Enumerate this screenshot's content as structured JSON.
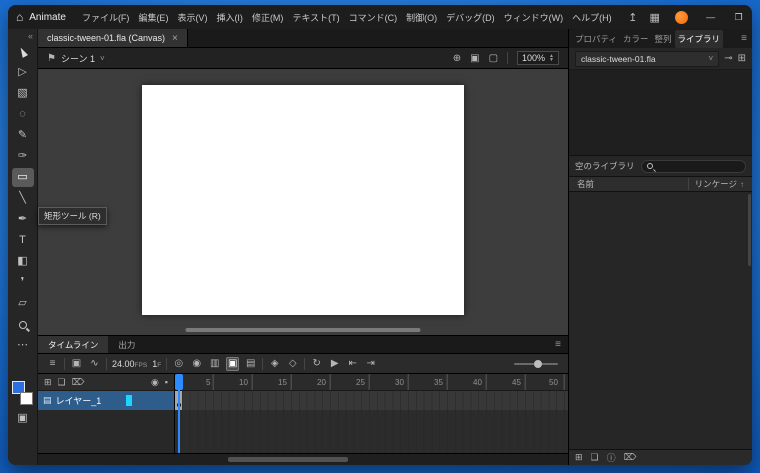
{
  "titlebar": {
    "app_name": "Animate",
    "menus": [
      "ファイル(F)",
      "編集(E)",
      "表示(V)",
      "挿入(I)",
      "修正(M)",
      "テキスト(T)",
      "コマンド(C)",
      "制御(O)",
      "デバッグ(D)",
      "ウィンドウ(W)",
      "ヘルプ(H)"
    ],
    "icons": {
      "home": "⌂",
      "share": "↥",
      "workspace": "▦"
    },
    "window_controls": {
      "minimize": "—",
      "maximize": "❐",
      "close": "✕"
    }
  },
  "document_tab": {
    "title": "classic-tween-01.fla (Canvas)",
    "close_glyph": "×"
  },
  "toolbar": {
    "collapse_glyph": "«",
    "tooltip": "矩形ツール (R)",
    "tools": {
      "subselection": "▷",
      "transform": "▧",
      "lasso": "◌",
      "brush": "✎",
      "paint_brush": "✑",
      "rectangle": "▭",
      "line": "╲",
      "pen": "✒",
      "text": "T",
      "bucket": "◧",
      "eyedropper": "❜",
      "eraser": "▱",
      "more": "⋯",
      "options": "▣"
    }
  },
  "stage_bar": {
    "scene_label": "シーン 1",
    "zoom_value": "100%",
    "icons": {
      "scene": "⚑",
      "chevron": "˅",
      "center": "⊕",
      "camera": "▣",
      "clip": "▢",
      "spin_up": "▲",
      "spin_down": "▼"
    }
  },
  "timeline": {
    "tabs": [
      "タイムライン",
      "出力"
    ],
    "fps_value": "24.00",
    "fps_label": "FPS",
    "frame_value": "1",
    "frame_label": "F",
    "layer_name": "レイヤー_1",
    "ruler": [
      "5",
      "10",
      "15",
      "20",
      "25",
      "30",
      "35",
      "40",
      "45",
      "50"
    ],
    "icons": {
      "menu": "≡",
      "layers": "≡",
      "camera": "▣",
      "graph": "∿",
      "onion_skin": "◎",
      "onion_outline": "◉",
      "span_edit": "▥",
      "edit_multiple": "▣",
      "marker": "▤",
      "insert_keyframe": "◈",
      "insert_blank_keyframe": "◇",
      "loop": "↻",
      "play": "▶",
      "step_back": "⇤",
      "step_forward": "⇥",
      "new_layer": "⊞",
      "new_folder": "❏",
      "delete_layer": "⌦",
      "show_hide": "◉",
      "lock": "▪"
    }
  },
  "library": {
    "panel_tabs": [
      "プロパティ",
      "カラー",
      "整列",
      "ライブラリ"
    ],
    "document_name": "classic-tween-01.fla",
    "empty_label": "空のライブラリ",
    "columns": {
      "name": "名前",
      "linkage": "リンケージ"
    },
    "icons": {
      "menu": "≡",
      "pin": "⊸",
      "new_panel": "⊞",
      "chevron": "˅",
      "sort": "↑",
      "new_symbol": "⊞",
      "new_folder": "❏",
      "properties": "ⓘ",
      "delete": "⌦"
    }
  },
  "colors": {
    "fill_swatch": "#2b6fe0",
    "stroke_swatch": "#ffffff",
    "selected_layer": "#2e5d8c",
    "playhead": "#2e8bff",
    "stage_canvas": "#ffffff",
    "desktop": "#1465c8",
    "layer_outline": "#1ad6ff"
  }
}
